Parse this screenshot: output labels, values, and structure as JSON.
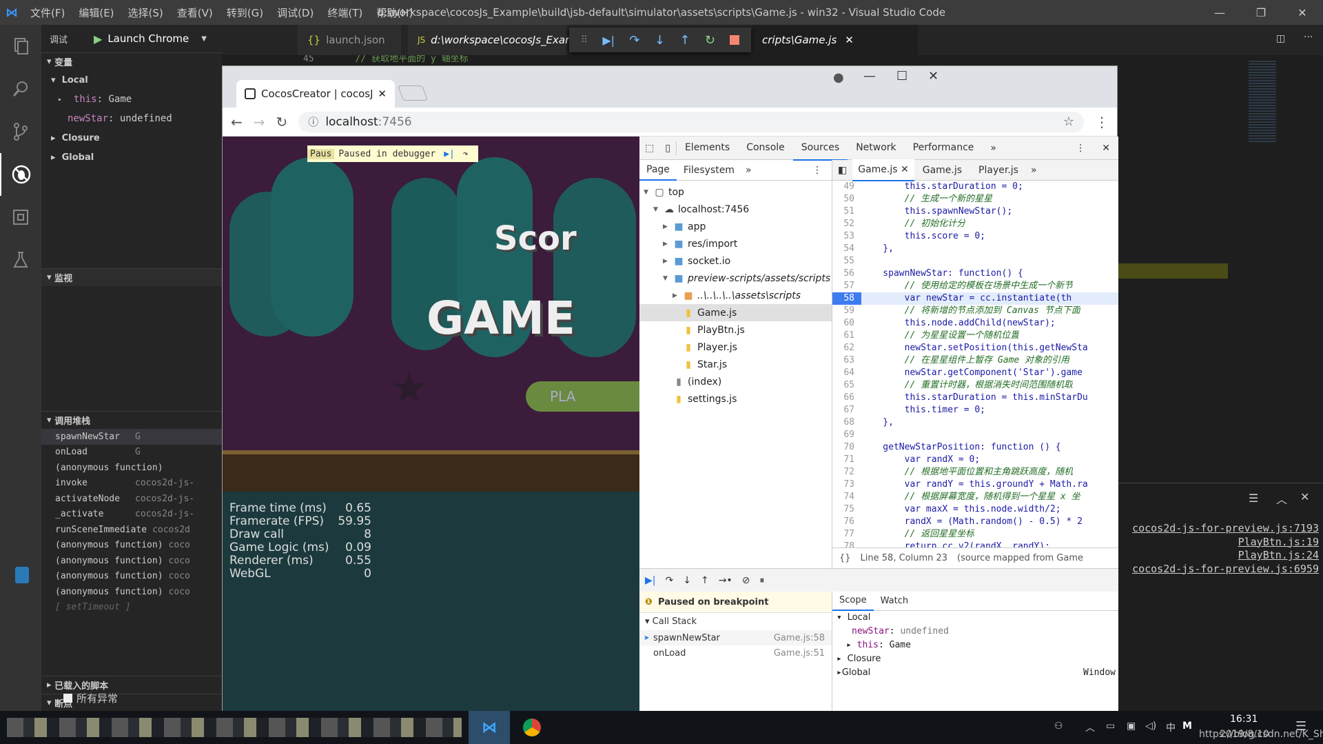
{
  "window": {
    "title": "d:\\workspace\\cocosJs_Example\\build\\jsb-default\\simulator\\assets\\scripts\\Game.js - win32 - Visual Studio Code",
    "menu": [
      "文件(F)",
      "编辑(E)",
      "选择(S)",
      "查看(V)",
      "转到(G)",
      "调试(D)",
      "终端(T)",
      "帮助(H)"
    ]
  },
  "sidebar": {
    "debug_label": "调试",
    "launch_config": "Launch Chrome",
    "variables_header": "变量",
    "local_label": "Local",
    "this_key": "this",
    "this_val": "Game",
    "newstar_key": "newStar",
    "newstar_val": "undefined",
    "closure_label": "Closure",
    "global_label": "Global",
    "watch_header": "监视",
    "callstack_header": "调用堆栈",
    "callstack": [
      {
        "fn": "spawnNewStar",
        "src": "G"
      },
      {
        "fn": "onLoad",
        "src": "G"
      },
      {
        "fn": "(anonymous function)",
        "src": ""
      },
      {
        "fn": "invoke",
        "src": "cocos2d-js-"
      },
      {
        "fn": "activateNode",
        "src": "cocos2d-js-"
      },
      {
        "fn": "_activate",
        "src": "cocos2d-js-"
      },
      {
        "fn": "runSceneImmediate",
        "src": "cocos2d"
      },
      {
        "fn": "(anonymous function)",
        "src": "coco"
      },
      {
        "fn": "(anonymous function)",
        "src": "coco"
      },
      {
        "fn": "(anonymous function)",
        "src": "coco"
      },
      {
        "fn": "(anonymous function)",
        "src": "coco"
      },
      {
        "fn": "[ setTimeout ]",
        "src": ""
      }
    ],
    "loaded_scripts": "已载入的脚本",
    "breakpoints": "断点",
    "all_exceptions": "所有异常"
  },
  "editor": {
    "tab1": "launch.json",
    "tab2": "d:\\workspace\\cocosJs_Examp",
    "tab3": "cripts\\Game.js",
    "bg_line_no": "45",
    "bg_line": "// 获取地平面的 y 轴坐标"
  },
  "chrome": {
    "tab_title": "CocosCreator | cocosJs",
    "url_host": "localhost",
    "url_port": ":7456",
    "paused_overlay": "Paused in debugger",
    "paused_short": "Paus",
    "game_score": "Scor",
    "game_title": "GAME",
    "play_btn": "PLA",
    "stats": [
      {
        "k": "Frame time (ms)",
        "v": "0.65"
      },
      {
        "k": "Framerate (FPS)",
        "v": "59.95"
      },
      {
        "k": "Draw call",
        "v": "8"
      },
      {
        "k": "Game Logic (ms)",
        "v": "0.09"
      },
      {
        "k": "Renderer (ms)",
        "v": "0.55"
      },
      {
        "k": "WebGL",
        "v": "0"
      }
    ]
  },
  "devtools": {
    "tabs": [
      "Elements",
      "Console",
      "Sources",
      "Network",
      "Performance"
    ],
    "nav_tabs": [
      "Page",
      "Filesystem"
    ],
    "tree": [
      {
        "label": "top",
        "indent": 0,
        "type": "frame"
      },
      {
        "label": "localhost:7456",
        "indent": 1,
        "type": "cloud"
      },
      {
        "label": "app",
        "indent": 2,
        "type": "folder"
      },
      {
        "label": "res/import",
        "indent": 2,
        "type": "folder"
      },
      {
        "label": "socket.io",
        "indent": 2,
        "type": "folder"
      },
      {
        "label": "preview-scripts/assets/scripts",
        "indent": 2,
        "type": "folder-open"
      },
      {
        "label": "..\\..\\..\\..\\assets\\scripts",
        "indent": 3,
        "type": "folder-orange"
      },
      {
        "label": "Game.js",
        "indent": 3,
        "type": "file-y"
      },
      {
        "label": "PlayBtn.js",
        "indent": 3,
        "type": "file-y"
      },
      {
        "label": "Player.js",
        "indent": 3,
        "type": "file-y"
      },
      {
        "label": "Star.js",
        "indent": 3,
        "type": "file-y"
      },
      {
        "label": "(index)",
        "indent": 2,
        "type": "file-g"
      },
      {
        "label": "settings.js",
        "indent": 2,
        "type": "file-y"
      }
    ],
    "code_tabs": [
      "Game.js",
      "Game.js",
      "Player.js"
    ],
    "code": [
      {
        "n": "49",
        "t": "        this.starDuration = 0;",
        "c": ""
      },
      {
        "n": "50",
        "t": "        // 生成一个新的星星",
        "c": "cm"
      },
      {
        "n": "51",
        "t": "        this.spawnNewStar();",
        "c": ""
      },
      {
        "n": "52",
        "t": "        // 初始化计分",
        "c": "cm"
      },
      {
        "n": "53",
        "t": "        this.score = 0;",
        "c": ""
      },
      {
        "n": "54",
        "t": "    },",
        "c": ""
      },
      {
        "n": "55",
        "t": "",
        "c": ""
      },
      {
        "n": "56",
        "t": "    spawnNewStar: function() {",
        "c": ""
      },
      {
        "n": "57",
        "t": "        // 使用给定的模板在场景中生成一个新节",
        "c": "cm"
      },
      {
        "n": "58",
        "t": "        var newStar = cc.instantiate(th",
        "c": "hl"
      },
      {
        "n": "59",
        "t": "        // 将新增的节点添加到 Canvas 节点下面",
        "c": "cm"
      },
      {
        "n": "60",
        "t": "        this.node.addChild(newStar);",
        "c": ""
      },
      {
        "n": "61",
        "t": "        // 为星星设置一个随机位置",
        "c": "cm"
      },
      {
        "n": "62",
        "t": "        newStar.setPosition(this.getNewSta",
        "c": ""
      },
      {
        "n": "63",
        "t": "        // 在星星组件上暂存 Game 对象的引用",
        "c": "cm"
      },
      {
        "n": "64",
        "t": "        newStar.getComponent('Star').game",
        "c": ""
      },
      {
        "n": "65",
        "t": "        // 重置计时器，根据消失时间范围随机取",
        "c": "cm"
      },
      {
        "n": "66",
        "t": "        this.starDuration = this.minStarDu",
        "c": ""
      },
      {
        "n": "67",
        "t": "        this.timer = 0;",
        "c": ""
      },
      {
        "n": "68",
        "t": "    },",
        "c": ""
      },
      {
        "n": "69",
        "t": "",
        "c": ""
      },
      {
        "n": "70",
        "t": "    getNewStarPosition: function () {",
        "c": ""
      },
      {
        "n": "71",
        "t": "        var randX = 0;",
        "c": ""
      },
      {
        "n": "72",
        "t": "        // 根据地平面位置和主角跳跃高度，随机",
        "c": "cm"
      },
      {
        "n": "73",
        "t": "        var randY = this.groundY + Math.ra",
        "c": ""
      },
      {
        "n": "74",
        "t": "        // 根据屏幕宽度，随机得到一个星星 x 坐",
        "c": "cm"
      },
      {
        "n": "75",
        "t": "        var maxX = this.node.width/2;",
        "c": ""
      },
      {
        "n": "76",
        "t": "        randX = (Math.random() - 0.5) * 2",
        "c": ""
      },
      {
        "n": "77",
        "t": "        // 返回星星坐标",
        "c": "cm"
      },
      {
        "n": "78",
        "t": "        return cc.v2(randX, randY);",
        "c": ""
      },
      {
        "n": "79",
        "t": "    }",
        "c": ""
      }
    ],
    "status_pos": "Line 58, Column 23",
    "status_map": "(source mapped from Game",
    "paused_bp": "Paused on breakpoint",
    "call_stack_label": "Call Stack",
    "stack": [
      {
        "fn": "spawnNewStar",
        "loc": "Game.js:58"
      },
      {
        "fn": "onLoad",
        "loc": "Game.js:51"
      }
    ],
    "scope_tab": "Scope",
    "watch_tab": "Watch",
    "scope_local": "Local",
    "scope_newstar": "newStar",
    "scope_newstar_val": "undefined",
    "scope_this": "this",
    "scope_this_val": "Game",
    "scope_closure": "Closure",
    "scope_global": "Global",
    "scope_window": "Window"
  },
  "right_panel": {
    "links": [
      "cocos2d-js-for-preview.js:7193",
      "PlayBtn.js:19",
      "PlayBtn.js:24",
      "cocos2d-js-for-preview.js:6959"
    ]
  },
  "taskbar": {
    "time": "16:31",
    "date": "2019/8/10",
    "ime": "中",
    "watermark": "https://blog.csdn.net/K_Shao"
  }
}
